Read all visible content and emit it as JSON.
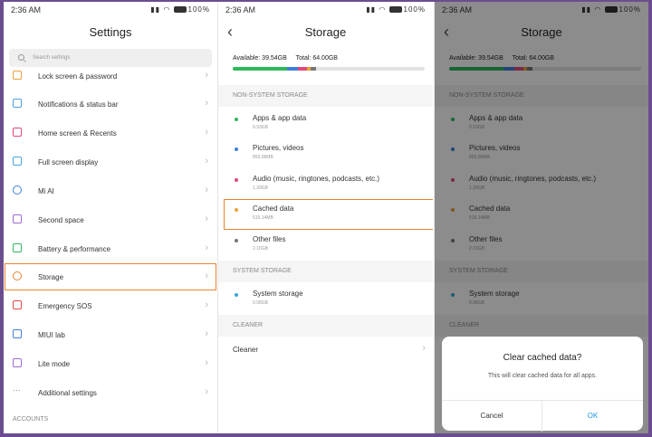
{
  "status": {
    "time": "2:36",
    "ampm": "AM",
    "battery": "100%"
  },
  "settings": {
    "title": "Settings",
    "search_placeholder": "Search settings",
    "items": [
      {
        "label": "Lock screen & password",
        "icon": "lock-icon"
      },
      {
        "label": "Notifications & status bar",
        "icon": "notification-icon"
      },
      {
        "label": "Home screen & Recents",
        "icon": "home-icon"
      },
      {
        "label": "Full screen display",
        "icon": "fullscreen-icon"
      },
      {
        "label": "Mi AI",
        "icon": "ai-icon"
      },
      {
        "label": "Second space",
        "icon": "second-space-icon"
      },
      {
        "label": "Battery & performance",
        "icon": "battery-icon"
      },
      {
        "label": "Storage",
        "icon": "storage-icon"
      },
      {
        "label": "Emergency SOS",
        "icon": "sos-icon"
      },
      {
        "label": "MIUI lab",
        "icon": "lab-icon"
      },
      {
        "label": "Lite mode",
        "icon": "lite-mode-icon"
      },
      {
        "label": "Additional settings",
        "icon": "more-icon"
      }
    ],
    "accounts_header": "ACCOUNTS"
  },
  "storage": {
    "title": "Storage",
    "available": "Available: 39.54GB",
    "total": "Total: 64.00GB",
    "bar_colors": [
      "#2eb85c",
      "#3d7fd9",
      "#e04a7a",
      "#e8a23a",
      "#777777",
      "#35a8d8"
    ],
    "non_system_header": "NON-SYSTEM STORAGE",
    "items": [
      {
        "name": "Apps & app data",
        "size": "9.93GB",
        "color": "#2eb85c"
      },
      {
        "name": "Pictures, videos",
        "size": "893.06MB",
        "color": "#3d7fd9"
      },
      {
        "name": "Audio (music, ringtones, podcasts, etc.)",
        "size": "1.39GB",
        "color": "#e04a7a"
      },
      {
        "name": "Cached data",
        "size": "519.14MB",
        "color": "#e8a23a"
      },
      {
        "name": "Other files",
        "size": "2.16GB",
        "color": "#777777"
      }
    ],
    "system_header": "SYSTEM STORAGE",
    "system_item": {
      "name": "System storage",
      "size": "9.98GB",
      "color": "#35a8d8"
    },
    "cleaner_header": "CLEANER",
    "cleaner_label": "Cleaner"
  },
  "dialog": {
    "title": "Clear cached data?",
    "message": "This will clear cached data for all apps.",
    "cancel": "Cancel",
    "ok": "OK"
  }
}
